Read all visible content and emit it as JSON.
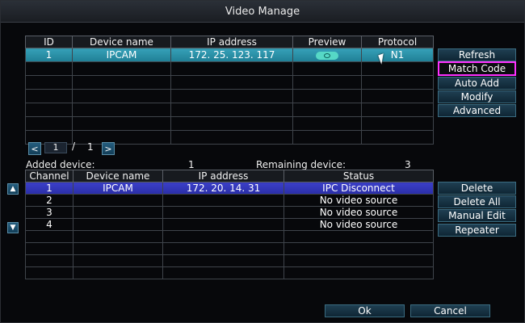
{
  "window": {
    "title": "Video Manage"
  },
  "top_table": {
    "headers": [
      "ID",
      "Device name",
      "IP address",
      "Preview",
      "Protocol"
    ],
    "rows": [
      {
        "id": "1",
        "device_name": "IPCAM",
        "ip": "172. 25. 123. 117",
        "preview_icon": "camera-preview-icon",
        "protocol": "N1"
      },
      {
        "id": "",
        "device_name": "",
        "ip": "",
        "preview_icon": "",
        "protocol": ""
      },
      {
        "id": "",
        "device_name": "",
        "ip": "",
        "preview_icon": "",
        "protocol": ""
      },
      {
        "id": "",
        "device_name": "",
        "ip": "",
        "preview_icon": "",
        "protocol": ""
      },
      {
        "id": "",
        "device_name": "",
        "ip": "",
        "preview_icon": "",
        "protocol": ""
      },
      {
        "id": "",
        "device_name": "",
        "ip": "",
        "preview_icon": "",
        "protocol": ""
      },
      {
        "id": "",
        "device_name": "",
        "ip": "",
        "preview_icon": "",
        "protocol": ""
      }
    ]
  },
  "right_buttons_top": {
    "refresh": "Refresh",
    "match_code": "Match Code",
    "auto_add": "Auto Add",
    "modify": "Modify",
    "advanced": "Advanced"
  },
  "pager": {
    "prev": "<",
    "current": "1",
    "separator": "/",
    "total": "1",
    "next": ">"
  },
  "device_summary": {
    "added_label": "Added device:",
    "added_value": "1",
    "remaining_label": "Remaining device:",
    "remaining_value": "3"
  },
  "bottom_table": {
    "headers": [
      "Channel",
      "Device name",
      "IP address",
      "Status"
    ],
    "rows": [
      {
        "channel": "1",
        "device_name": "IPCAM",
        "ip": "172. 20. 14. 31",
        "status": "IPC Disconnect"
      },
      {
        "channel": "2",
        "device_name": "",
        "ip": "",
        "status": "No video source"
      },
      {
        "channel": "3",
        "device_name": "",
        "ip": "",
        "status": "No video source"
      },
      {
        "channel": "4",
        "device_name": "",
        "ip": "",
        "status": "No video source"
      },
      {
        "channel": "",
        "device_name": "",
        "ip": "",
        "status": ""
      },
      {
        "channel": "",
        "device_name": "",
        "ip": "",
        "status": ""
      },
      {
        "channel": "",
        "device_name": "",
        "ip": "",
        "status": ""
      },
      {
        "channel": "",
        "device_name": "",
        "ip": "",
        "status": ""
      }
    ]
  },
  "side_arrows": {
    "up": "▲",
    "down": "▼"
  },
  "right_buttons_bottom": {
    "delete": "Delete",
    "delete_all": "Delete All",
    "manual_edit": "Manual Edit",
    "repeater": "Repeater"
  },
  "footer": {
    "ok": "Ok",
    "cancel": "Cancel"
  },
  "colors": {
    "selected_cyan": "#2a8fa6",
    "selected_blue": "#3237c0",
    "highlight_border": "#ff30ff"
  }
}
